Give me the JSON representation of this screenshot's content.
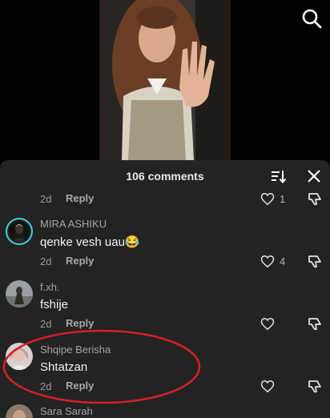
{
  "header": {
    "comment_count": "106 comments"
  },
  "icons": {
    "search": "search-icon",
    "sort": "sort-icon",
    "close": "close-icon",
    "like": "heart-icon",
    "dislike": "thumbs-down-icon"
  },
  "colors": {
    "panel_bg": "#232323",
    "annotation": "#d61f2a",
    "story_ring": "#3fd0d4"
  },
  "comments": [
    {
      "time": "2d",
      "reply": "Reply",
      "likes": "1"
    },
    {
      "username": "MIRA ASHIKU",
      "text": "qenke vesh uau😂",
      "time": "2d",
      "reply": "Reply",
      "likes": "4"
    },
    {
      "username": "f.xh.",
      "text": "fshije",
      "time": "2d",
      "reply": "Reply",
      "likes": ""
    },
    {
      "username": "Shqipe Berisha",
      "text": "Shtatzan",
      "time": "2d",
      "reply": "Reply",
      "likes": ""
    },
    {
      "username": "Sara Sarah"
    }
  ]
}
